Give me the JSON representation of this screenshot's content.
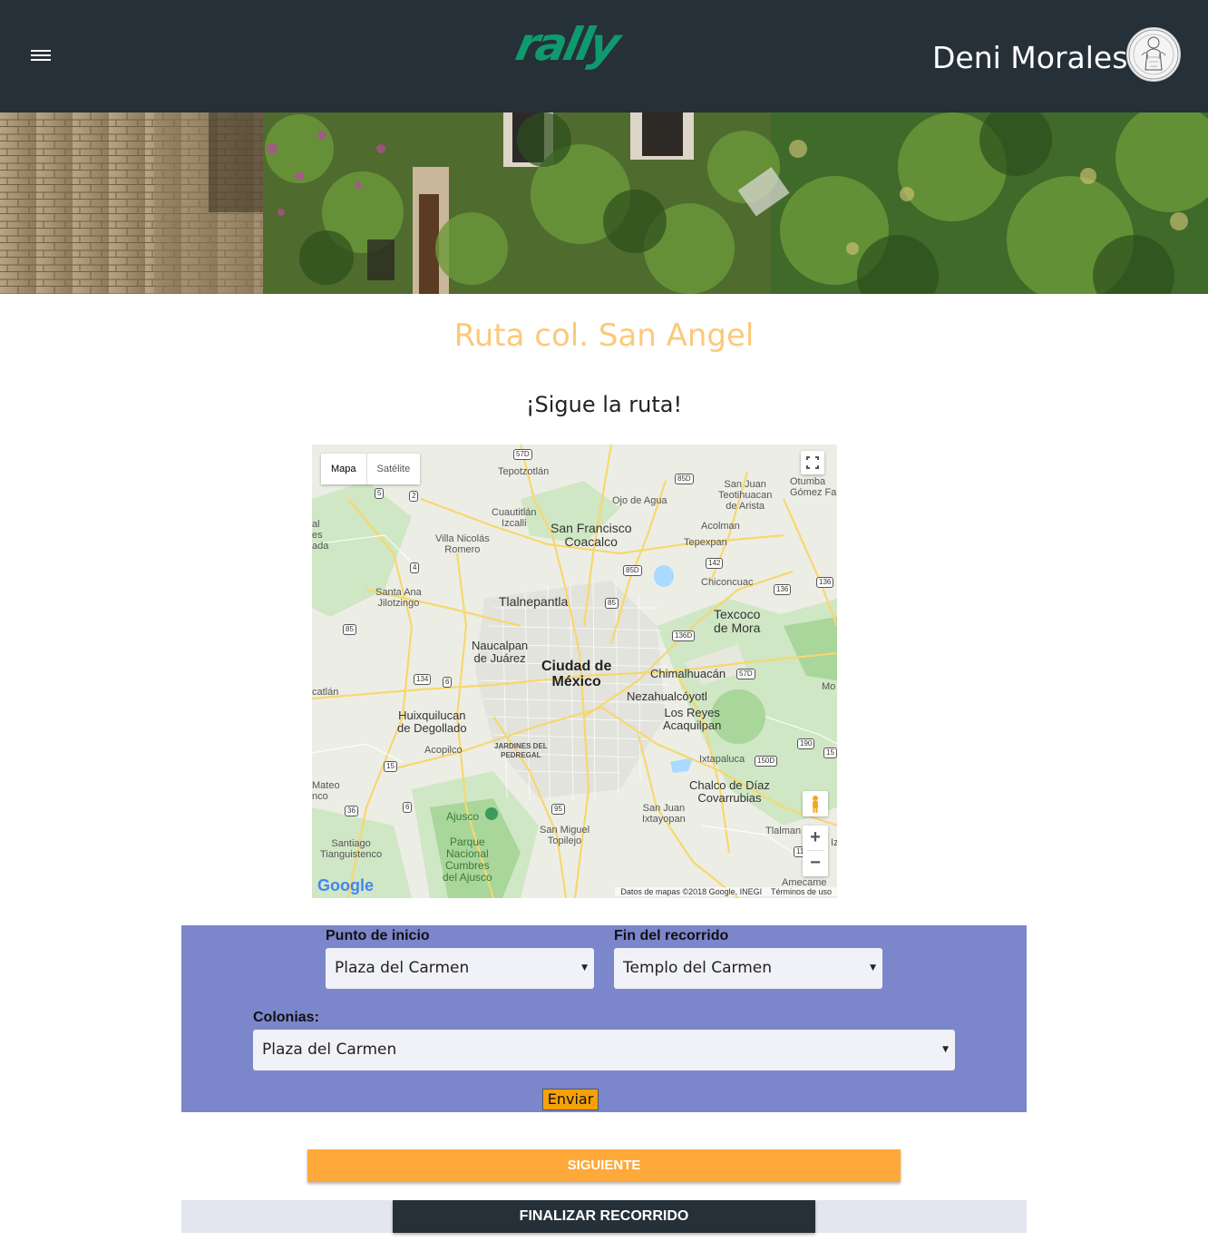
{
  "header": {
    "logo_text": "rally",
    "user_name": "Deni Morales",
    "colors": {
      "bar": "#263038",
      "logo": "#0f9a6e"
    }
  },
  "icons": {
    "menu": "hamburger-icon",
    "avatar": "user-avatar",
    "pegman": "pegman-icon",
    "fullscreen": "fullscreen-icon"
  },
  "page": {
    "title": "Ruta col. San Angel",
    "subtitle": "¡Sigue la ruta!"
  },
  "map": {
    "type_buttons": [
      "Mapa",
      "Satélite"
    ],
    "selected_type": "Mapa",
    "zoom_in": "+",
    "zoom_out": "−",
    "attribution": "Datos de mapas ©2018 Google, INEGI",
    "terms": "Términos de uso",
    "google_logo": "Google",
    "labels": {
      "tepotzotlan": "Tepotzotlán",
      "ojo_de_agua": "Ojo de Agua",
      "san_juan_teo": "San Juan\nTeotihuacan\nde Arista",
      "otumba": "Otumba\nGómez Fa",
      "cuautitlan": "Cuautitlán\nIzcalli",
      "san_francisco": "San Francisco\nCoacalco",
      "acolman": "Acolman",
      "tepexpan": "Tepexpan",
      "villa_nicolas": "Villa Nicolás\nRomero",
      "chiconcuac": "Chiconcuac",
      "santa_ana": "Santa Ana\nJilotzingo",
      "tlalnepantla": "Tlalnepantla",
      "texcoco": "Texcoco\nde Mora",
      "naucalpan": "Naucalpan\nde Juárez",
      "cdmx": "Ciudad de\nMéxico",
      "chimalhuacan": "Chimalhuacán",
      "nezahualcoyotl": "Nezahualcóyotl",
      "los_reyes": "Los Reyes\nAcaquilpan",
      "huixquilucan": "Huixquilucan\nde Degollado",
      "acopilco": "Acopilco",
      "jardines": "JARDINES DEL\nPEDREGAL",
      "ixtapaluca": "Ixtapaluca",
      "chalco": "Chalco de Díaz\nCovarrubias",
      "ajusco": "Ajusco",
      "san_juan_ixtay": "San Juan\nIxtayopan",
      "parque": "Parque\nNacional\nCumbres\ndel Ajusco",
      "san_miguel": "San Miguel\nTopilejo",
      "santiago": "Santiago\nTianguistenco",
      "tlalman": "Tlalman",
      "amecameca": "Amecame",
      "edge_al": "al\nes\nada",
      "edge_catlan": "catlán",
      "edge_mateo": "Mateo\nnco",
      "edge_mo": "Mo",
      "edge_iz": "Iz"
    },
    "shields": {
      "s57d_top": "57D",
      "s85d_top": "85D",
      "s5": "5",
      "s2": "2",
      "s85d_mid": "85D",
      "s142": "142",
      "s136_a": "136",
      "s136_b": "136",
      "s4": "4",
      "s85_a": "85",
      "s85_b": "85",
      "s136d": "136D",
      "s134": "134",
      "s6_a": "6",
      "s57d_low": "57D",
      "s190": "190",
      "s15_a": "15",
      "s150d": "150D",
      "s15_b": "15",
      "s6_b": "6",
      "s36": "36",
      "s95": "95",
      "s11": "11"
    }
  },
  "form": {
    "start_label": "Punto de inicio",
    "start_value": "Plaza del Carmen",
    "end_label": "Fin del recorrido",
    "end_value": "Templo del Carmen",
    "colonias_label": "Colonias:",
    "colonias_value": "Plaza del Carmen",
    "caret": "▼",
    "submit_label": "Enviar",
    "panel_color": "#7b86cb"
  },
  "actions": {
    "next_label": "SIGUIENTE",
    "finish_label": "FINALIZAR RECORRIDO",
    "colors": {
      "next": "#ffa93a",
      "finish": "#263038"
    }
  }
}
